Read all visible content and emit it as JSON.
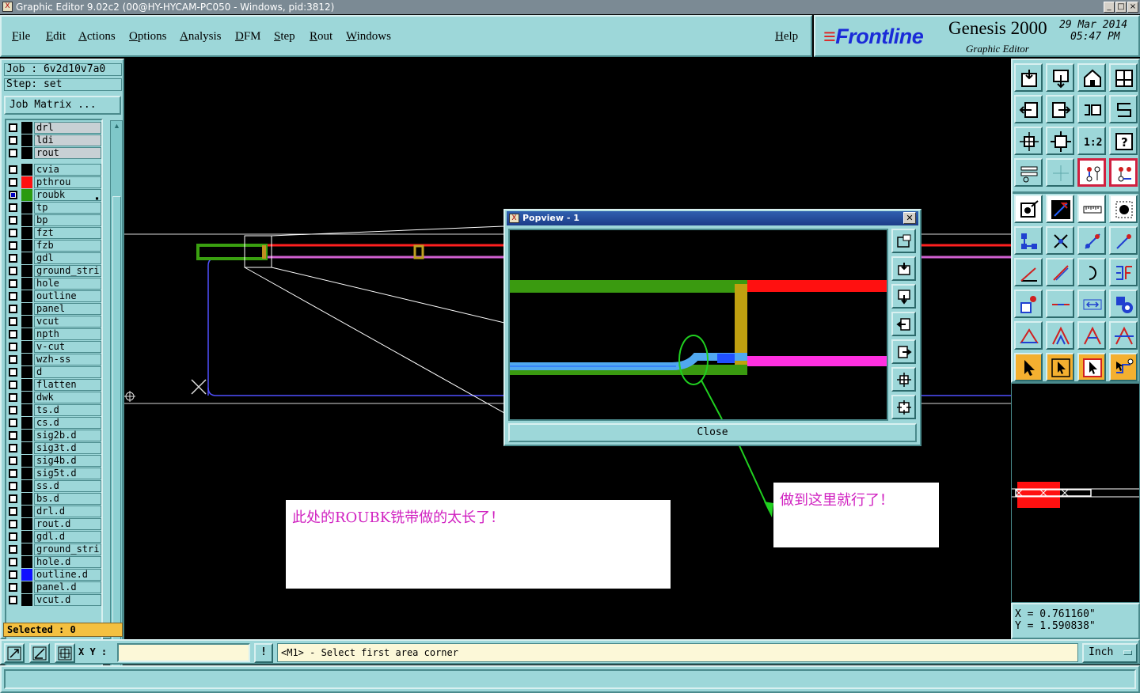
{
  "window": {
    "title": "Graphic Editor 9.02c2 (00@HY-HYCAM-PC050 - Windows, pid:3812)",
    "buttons": [
      "_",
      "□",
      "×"
    ]
  },
  "menu": {
    "items": [
      "File",
      "Edit",
      "Actions",
      "Options",
      "Analysis",
      "DFM",
      "Step",
      "Rout",
      "Windows"
    ],
    "help": "Help"
  },
  "brand": {
    "logo": "Frontline",
    "product": "Genesis 2000",
    "subtitle": "Graphic Editor",
    "date": "29 Mar 2014",
    "time": "05:47 PM",
    "colors": {
      "logo": "#1a2bd8",
      "accent": "#e02020"
    }
  },
  "left_panel": {
    "job_label": "Job : 6v2d10v7a0",
    "step_label": "Step: set",
    "job_matrix_button": "Job Matrix ...",
    "selected_label": "Selected : 0",
    "layers": [
      {
        "name": "drl",
        "color": "#000000",
        "board": true
      },
      {
        "name": "ldi",
        "color": "#000000",
        "board": true
      },
      {
        "name": "rout",
        "color": "#000000",
        "board": true
      },
      {
        "name": "cvia",
        "color": "#000000"
      },
      {
        "name": "pthrou",
        "color": "#ff1010"
      },
      {
        "name": "roubk",
        "color": "#2a9a10",
        "checked": true,
        "indicator": "▪"
      },
      {
        "name": "tp",
        "color": "#000000"
      },
      {
        "name": "bp",
        "color": "#000000"
      },
      {
        "name": "fzt",
        "color": "#000000"
      },
      {
        "name": "fzb",
        "color": "#000000"
      },
      {
        "name": "gdl",
        "color": "#000000"
      },
      {
        "name": "ground_stri",
        "color": "#000000"
      },
      {
        "name": "hole",
        "color": "#000000"
      },
      {
        "name": "outline",
        "color": "#000000"
      },
      {
        "name": "panel",
        "color": "#000000"
      },
      {
        "name": "vcut",
        "color": "#000000"
      },
      {
        "name": "npth",
        "color": "#000000"
      },
      {
        "name": "v-cut",
        "color": "#000000"
      },
      {
        "name": "wzh-ss",
        "color": "#000000"
      },
      {
        "name": "d",
        "color": "#000000"
      },
      {
        "name": "flatten",
        "color": "#000000"
      },
      {
        "name": "dwk",
        "color": "#000000"
      },
      {
        "name": "ts.d",
        "color": "#000000"
      },
      {
        "name": "cs.d",
        "color": "#000000"
      },
      {
        "name": "sig2b.d",
        "color": "#000000"
      },
      {
        "name": "sig3t.d",
        "color": "#000000"
      },
      {
        "name": "sig4b.d",
        "color": "#000000"
      },
      {
        "name": "sig5t.d",
        "color": "#000000"
      },
      {
        "name": "ss.d",
        "color": "#000000"
      },
      {
        "name": "bs.d",
        "color": "#000000"
      },
      {
        "name": "drl.d",
        "color": "#000000"
      },
      {
        "name": "rout.d",
        "color": "#000000"
      },
      {
        "name": "gdl.d",
        "color": "#000000"
      },
      {
        "name": "ground_stri",
        "color": "#000000"
      },
      {
        "name": "hole.d",
        "color": "#000000"
      },
      {
        "name": "outline.d",
        "color": "#1010ff"
      },
      {
        "name": "panel.d",
        "color": "#000000"
      },
      {
        "name": "vcut.d",
        "color": "#000000"
      }
    ]
  },
  "popview": {
    "title": "Popview - 1",
    "close_label": "Close",
    "side_buttons": [
      "zoom-fit-icon",
      "zoom-home-icon",
      "pan-down-icon",
      "pan-left-icon",
      "pan-right-icon",
      "zoom-out-icon",
      "zoom-in-icon"
    ]
  },
  "annotations": {
    "note1": "此处的ROUBK铣带做的太长了！",
    "note2": "做到这里就行了！"
  },
  "coords": {
    "x": "X = 0.761160\"",
    "y": "Y = 1.590838\""
  },
  "bottom": {
    "xy_label": "X Y :",
    "xy_value": "",
    "excl": "!",
    "prompt": "<M1> - Select first area corner",
    "units": "Inch"
  }
}
